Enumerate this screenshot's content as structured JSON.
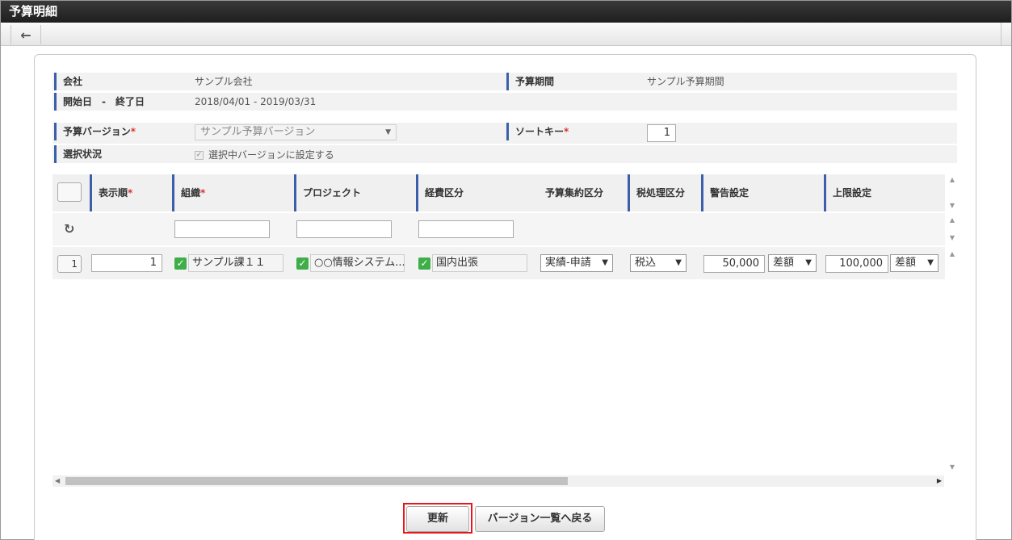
{
  "window": {
    "title": "予算明細"
  },
  "toolbar": {
    "back_icon": "←"
  },
  "info": {
    "company_label": "会社",
    "company_value": "サンプル会社",
    "period_label": "予算期間",
    "period_value": "サンプル予算期間",
    "dates_label": "開始日　-　終了日",
    "dates_value": "2018/04/01 - 2019/03/31",
    "version_label": "予算バージョン",
    "version_value": "サンプル予算バージョン",
    "sortkey_label": "ソートキー",
    "sortkey_value": "1",
    "status_label": "選択状況",
    "status_checkbox_label": "選択中バージョンに設定する",
    "required_mark": "*"
  },
  "grid": {
    "columns": [
      "表示順",
      "組織",
      "プロジェクト",
      "経費区分",
      "予算集約区分",
      "税処理区分",
      "警告設定",
      "上限設定"
    ],
    "required_mark": "*",
    "refresh_icon": "↻",
    "row": {
      "row_number": "1",
      "display_order": "1",
      "organization": "サンプル課１１",
      "project": "○○情報システム...",
      "expense_category": "国内出張",
      "aggregation": "実績-申請",
      "tax": "税込",
      "warning_amount": "50,000",
      "warning_type": "差額",
      "limit_amount": "100,000",
      "limit_type": "差額"
    }
  },
  "buttons": {
    "update": "更新",
    "back_to_list": "バージョン一覧へ戻る"
  }
}
